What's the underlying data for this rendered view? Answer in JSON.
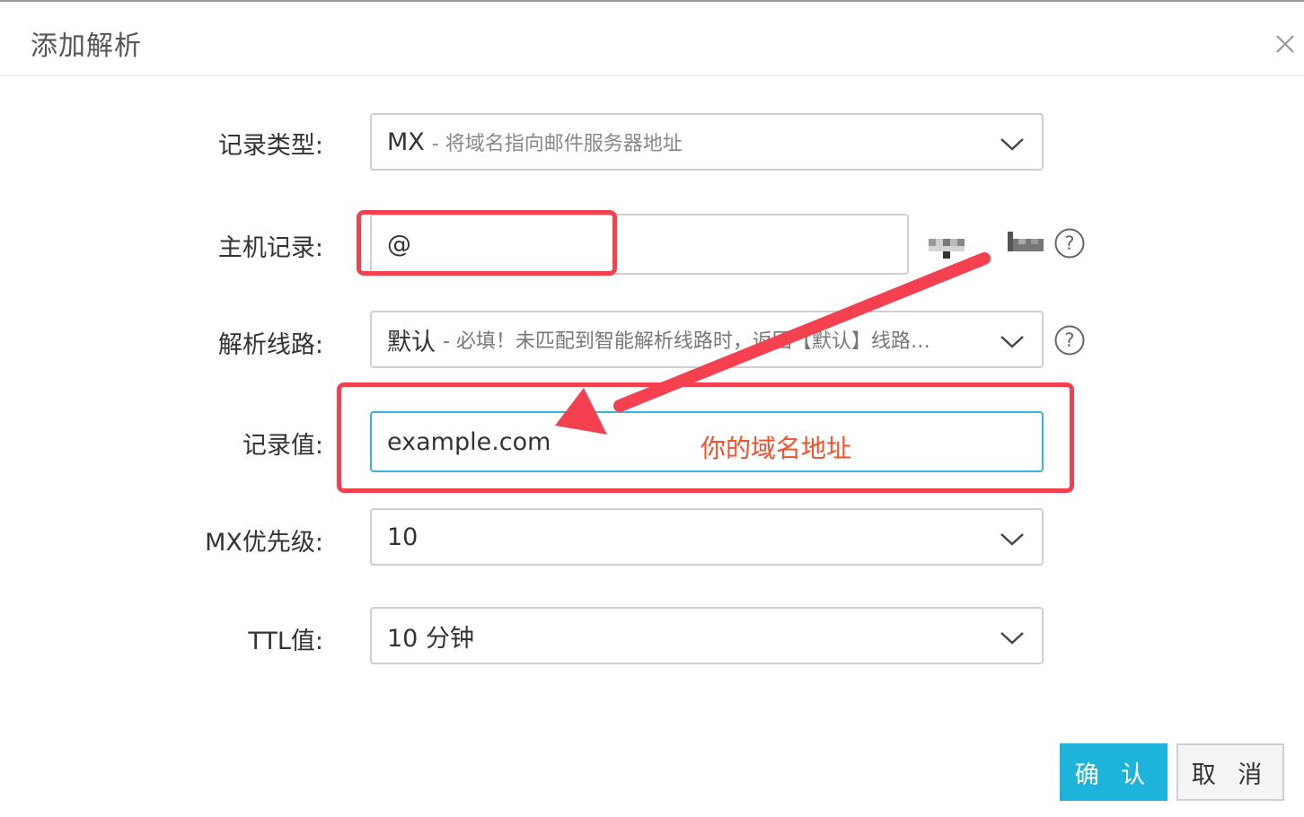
{
  "dialog": {
    "title": "添加解析",
    "close_label": "×"
  },
  "form": {
    "record_type": {
      "label": "记录类型:",
      "value": "MX",
      "description": "- 将域名指向邮件服务器地址"
    },
    "host_record": {
      "label": "主机记录:",
      "value": "@"
    },
    "line": {
      "label": "解析线路:",
      "value": "默认",
      "description": "- 必填！未匹配到智能解析线路时，返回【默认】线路…"
    },
    "record_value": {
      "label": "记录值:",
      "value": "example.com"
    },
    "mx_priority": {
      "label": "MX优先级:",
      "value": "10"
    },
    "ttl": {
      "label": "TTL值:",
      "value": "10 分钟"
    }
  },
  "annotation": {
    "text": "你的域名地址",
    "color": "#f5502a",
    "highlight_color": "#f5404f"
  },
  "buttons": {
    "confirm": "确 认",
    "cancel": "取 消"
  },
  "colors": {
    "primary": "#1eb3db",
    "focus_border": "#3ab4dc"
  },
  "icons": {
    "close": "close-icon",
    "dropdown": "chevron-down-icon",
    "help": "help-icon"
  }
}
